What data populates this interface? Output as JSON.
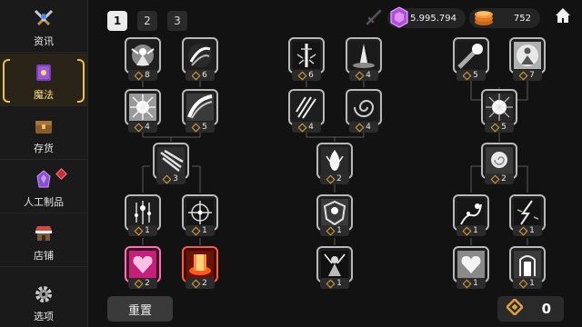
{
  "sidebar": {
    "items": [
      {
        "label": "资讯",
        "icon": "crossed-swords-icon"
      },
      {
        "label": "魔法",
        "icon": "spellbook-icon"
      },
      {
        "label": "存货",
        "icon": "treasure-chest-icon"
      },
      {
        "label": "人工制品",
        "icon": "purple-crystal-icon"
      },
      {
        "label": "店铺",
        "icon": "shop-stall-icon"
      },
      {
        "label": "选项",
        "icon": "gear-icon"
      }
    ]
  },
  "tabs": [
    "1",
    "2",
    "3"
  ],
  "currency": {
    "gems": "5.995.794",
    "coins": "752"
  },
  "skills": [
    {
      "level": "8",
      "icon": "holy-knight-icon"
    },
    {
      "level": "6",
      "icon": "wind-slash-icon"
    },
    {
      "level": "4",
      "icon": "light-burst-icon"
    },
    {
      "level": "5",
      "icon": "arc-slash-icon"
    },
    {
      "level": "3",
      "icon": "blade-rain-icon"
    },
    {
      "level": "1",
      "icon": "sparkle-rain-icon"
    },
    {
      "level": "1",
      "icon": "crosshair-icon"
    },
    {
      "level": "2",
      "icon": "pink-heart-icon"
    },
    {
      "level": "2",
      "icon": "fire-pillar-icon"
    },
    {
      "level": "6",
      "icon": "sword-shatter-icon"
    },
    {
      "level": "4",
      "icon": "light-pillar-icon"
    },
    {
      "level": "4",
      "icon": "claw-slash-icon"
    },
    {
      "level": "4",
      "icon": "vortex-icon"
    },
    {
      "level": "2",
      "icon": "white-flame-icon"
    },
    {
      "level": "1",
      "icon": "guardian-shield-icon"
    },
    {
      "level": "1",
      "icon": "dark-warrior-icon"
    },
    {
      "level": "5",
      "icon": "comet-icon"
    },
    {
      "level": "7",
      "icon": "radiant-figure-icon"
    },
    {
      "level": "5",
      "icon": "star-burst-icon"
    },
    {
      "level": "2",
      "icon": "white-rose-icon"
    },
    {
      "level": "1",
      "icon": "healing-vine-icon"
    },
    {
      "level": "1",
      "icon": "ice-lightning-icon"
    },
    {
      "level": "1",
      "icon": "spirit-heart-icon"
    },
    {
      "level": "1",
      "icon": "light-gate-icon"
    }
  ],
  "bottom": {
    "reset_label": "重置",
    "points": "0"
  }
}
